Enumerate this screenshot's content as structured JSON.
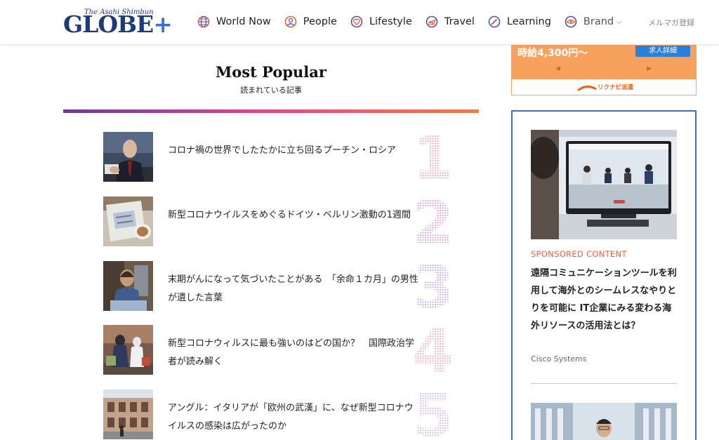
{
  "header": {
    "logo_sub": "The Asahi Shimbun",
    "logo_main": "GLOBE",
    "logo_plus": "+",
    "nav": [
      {
        "label": "World Now",
        "icon": "globe-icon"
      },
      {
        "label": "People",
        "icon": "people-icon"
      },
      {
        "label": "Lifestyle",
        "icon": "heart-icon"
      },
      {
        "label": "Travel",
        "icon": "travel-icon"
      },
      {
        "label": "Learning",
        "icon": "pencil-icon"
      },
      {
        "label": "Brand",
        "icon": "eye-icon"
      }
    ],
    "mailmag": "メルマガ登録"
  },
  "most_popular": {
    "title": "Most Popular",
    "subtitle": "読まれている記事",
    "items": [
      {
        "rank": "1",
        "title": "コロナ禍の世界でしたたかに立ち回るプーチン・ロシア"
      },
      {
        "rank": "2",
        "title": "新型コロナウイルスをめぐるドイツ・ベルリン激動の1週間"
      },
      {
        "rank": "3",
        "title": "末期がんになって気づいたことがある　「余命１カ月」の男性が遺した言葉"
      },
      {
        "rank": "4",
        "title": "新型コロナウィルスに最も強いのはどの国か？　国際政治学者が読み解く"
      },
      {
        "rank": "5",
        "title": "アングル：イタリアが「欧州の武漢」に、なぜ新型コロナウイルスの感染は広がったのか"
      }
    ]
  },
  "sidebar": {
    "ad": {
      "wage": "時給4,300円～",
      "button": "求人詳細",
      "brand": "リクナビ派遣",
      "arrow_left": "◀",
      "arrow_right": "▶"
    },
    "sponsored": {
      "label": "SPONSORED CONTENT",
      "title": "遠隔コミュニケーションツールを利用して海外とのシームレスなやりとりを可能に IT企業にみる変わる海外リソースの活用法とは？",
      "company": "Cisco Systems"
    }
  },
  "colors": {
    "brand_blue": "#1d3b7a",
    "accent_orange": "#e8623a",
    "gradient_start": "#6a3a9a",
    "gradient_end": "#f07a4a",
    "sponsored_border": "#3a6fd0"
  }
}
